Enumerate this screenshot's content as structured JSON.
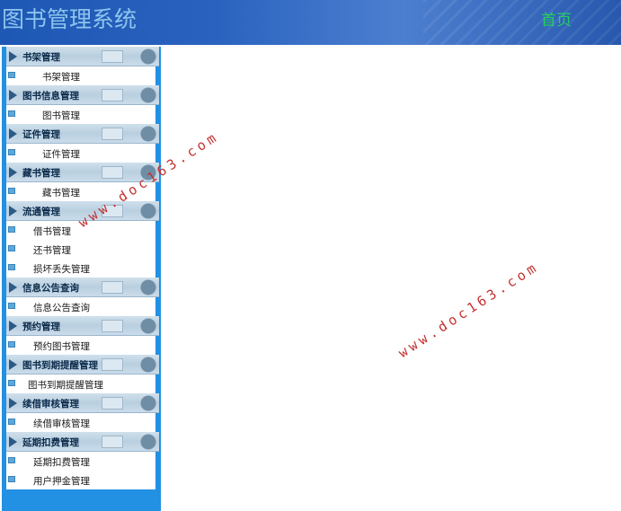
{
  "header": {
    "title": "图书管理系统",
    "home_link": "首页"
  },
  "sidebar": {
    "groups": [
      {
        "title": "书架管理",
        "items": [
          "书架管理"
        ]
      },
      {
        "title": "图书信息管理",
        "items": [
          "图书管理"
        ]
      },
      {
        "title": "证件管理",
        "items": [
          "证件管理"
        ]
      },
      {
        "title": "藏书管理",
        "items": [
          "藏书管理"
        ]
      },
      {
        "title": "流通管理",
        "items": [
          "借书管理",
          "还书管理",
          "损坏丢失管理"
        ]
      },
      {
        "title": "信息公告查询",
        "items": [
          "信息公告查询"
        ]
      },
      {
        "title": "预约管理",
        "items": [
          "预约图书管理"
        ]
      },
      {
        "title": "图书到期提醒管理",
        "items": [
          "图书到期提醒管理"
        ]
      },
      {
        "title": "续借审核管理",
        "items": [
          "续借审核管理"
        ]
      },
      {
        "title": "延期扣费管理",
        "items": [
          "延期扣费管理",
          "用户押金管理"
        ]
      }
    ]
  },
  "watermarks": [
    "www.doc163.com",
    "www.doc163.com"
  ],
  "colors": {
    "header_bg": "#2a63bf",
    "title_color": "#8ec4ee",
    "home_color": "#26d05c",
    "sidebar_border": "#2290e3",
    "watermark": "#c43030"
  }
}
